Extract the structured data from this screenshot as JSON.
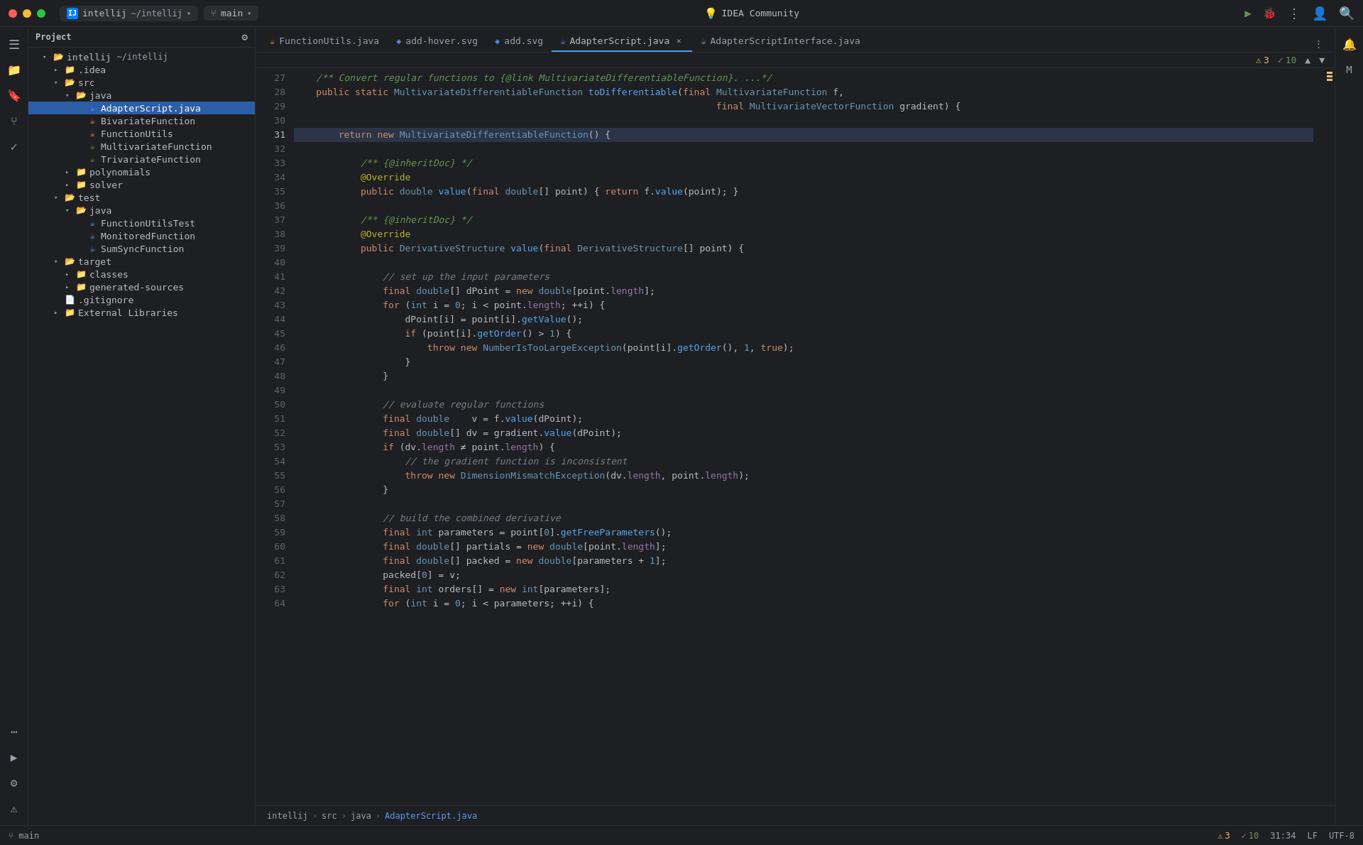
{
  "titlebar": {
    "project_name": "intellij",
    "project_path": "~/intellij",
    "branch_icon": "⑂",
    "branch_name": "main",
    "idea_label": "IDEA Community",
    "run_icon": "▶",
    "debug_icon": "🐛",
    "more_icon": "⋮",
    "profile_icon": "👤",
    "search_icon": "🔍"
  },
  "sidebar": {
    "title": "Project",
    "tree": [
      {
        "id": 1,
        "label": "intellij ~/intellij",
        "indent": 1,
        "type": "root",
        "expanded": true,
        "arrow": "▾"
      },
      {
        "id": 2,
        "label": ".idea",
        "indent": 2,
        "type": "folder",
        "expanded": false,
        "arrow": "▸"
      },
      {
        "id": 3,
        "label": "src",
        "indent": 2,
        "type": "folder",
        "expanded": true,
        "arrow": "▾"
      },
      {
        "id": 4,
        "label": "java",
        "indent": 3,
        "type": "folder",
        "expanded": true,
        "arrow": "▾"
      },
      {
        "id": 5,
        "label": "AdapterScript.java",
        "indent": 4,
        "type": "java-blue",
        "selected": true
      },
      {
        "id": 6,
        "label": "BivariateFunction",
        "indent": 4,
        "type": "java-orange"
      },
      {
        "id": 7,
        "label": "FunctionUtils",
        "indent": 4,
        "type": "java-orange"
      },
      {
        "id": 8,
        "label": "MultivariateFunction",
        "indent": 4,
        "type": "java-green"
      },
      {
        "id": 9,
        "label": "TrivariateFunction",
        "indent": 4,
        "type": "java-green"
      },
      {
        "id": 10,
        "label": "polynomials",
        "indent": 3,
        "type": "folder",
        "expanded": false,
        "arrow": "▸"
      },
      {
        "id": 11,
        "label": "solver",
        "indent": 3,
        "type": "folder",
        "expanded": false,
        "arrow": "▸"
      },
      {
        "id": 12,
        "label": "test",
        "indent": 2,
        "type": "folder",
        "expanded": true,
        "arrow": "▾"
      },
      {
        "id": 13,
        "label": "java",
        "indent": 3,
        "type": "folder",
        "expanded": true,
        "arrow": "▾"
      },
      {
        "id": 14,
        "label": "FunctionUtilsTest",
        "indent": 4,
        "type": "java-blue"
      },
      {
        "id": 15,
        "label": "MonitoredFunction",
        "indent": 4,
        "type": "java-blue"
      },
      {
        "id": 16,
        "label": "SumSyncFunction",
        "indent": 4,
        "type": "java-blue"
      },
      {
        "id": 17,
        "label": "target",
        "indent": 2,
        "type": "folder",
        "expanded": true,
        "arrow": "▾"
      },
      {
        "id": 18,
        "label": "classes",
        "indent": 3,
        "type": "folder",
        "expanded": false,
        "arrow": "▸"
      },
      {
        "id": 19,
        "label": "generated-sources",
        "indent": 3,
        "type": "folder",
        "expanded": false,
        "arrow": "▸"
      },
      {
        "id": 20,
        "label": ".gitignore",
        "indent": 2,
        "type": "file"
      },
      {
        "id": 21,
        "label": "External Libraries",
        "indent": 2,
        "type": "folder",
        "expanded": false,
        "arrow": "▸"
      }
    ]
  },
  "tabs": [
    {
      "id": 1,
      "label": "FunctionUtils.java",
      "type": "java",
      "active": false,
      "modified": false
    },
    {
      "id": 2,
      "label": "add-hover.svg",
      "type": "svg",
      "active": false,
      "modified": false
    },
    {
      "id": 3,
      "label": "add.svg",
      "type": "svg",
      "active": false,
      "modified": false
    },
    {
      "id": 4,
      "label": "AdapterScript.java",
      "type": "java",
      "active": true,
      "modified": false
    },
    {
      "id": 5,
      "label": "AdapterScriptInterface.java",
      "type": "java",
      "active": false,
      "modified": false
    }
  ],
  "editor": {
    "lines": [
      {
        "num": 27,
        "content": "    /** Convert regular functions to {@link MultivariateDifferentiableFunction}. ...*/"
      },
      {
        "num": 28,
        "content": "    public static MultivariateDifferentiableFunction toDifferentiable(final MultivariateFunction f,"
      },
      {
        "num": 29,
        "content": "                                                                            final MultivariateVectorFunction gradient) {"
      },
      {
        "num": 30,
        "content": ""
      },
      {
        "num": 31,
        "content": "        return new MultivariateDifferentiableFunction() {",
        "highlighted": true
      },
      {
        "num": 32,
        "content": ""
      },
      {
        "num": 33,
        "content": "            /** {@inheritDoc} */"
      },
      {
        "num": 34,
        "content": "            @Override"
      },
      {
        "num": 35,
        "content": "            public double value(final double[] point) { return f.value(point); }"
      },
      {
        "num": 36,
        "content": ""
      },
      {
        "num": 37,
        "content": "            /** {@inheritDoc} */"
      },
      {
        "num": 38,
        "content": "            @Override"
      },
      {
        "num": 39,
        "content": "            public DerivativeStructure value(final DerivativeStructure[] point) {"
      },
      {
        "num": 40,
        "content": ""
      },
      {
        "num": 41,
        "content": "                // set up the input parameters"
      },
      {
        "num": 42,
        "content": "                final double[] dPoint = new double[point.length];"
      },
      {
        "num": 43,
        "content": "                for (int i = 0; i < point.length; ++i) {"
      },
      {
        "num": 44,
        "content": "                    dPoint[i] = point[i].getValue();"
      },
      {
        "num": 45,
        "content": "                    if (point[i].getOrder() > 1) {"
      },
      {
        "num": 46,
        "content": "                        throw new NumberIsTooLargeException(point[i].getOrder(), 1, true);"
      },
      {
        "num": 47,
        "content": "                    }"
      },
      {
        "num": 48,
        "content": "                }"
      },
      {
        "num": 49,
        "content": ""
      },
      {
        "num": 50,
        "content": "                // evaluate regular functions"
      },
      {
        "num": 51,
        "content": "                final double    v = f.value(dPoint);"
      },
      {
        "num": 52,
        "content": "                final double[] dv = gradient.value(dPoint);"
      },
      {
        "num": 53,
        "content": "                if (dv.length ≠ point.length) {"
      },
      {
        "num": 54,
        "content": "                    // the gradient function is inconsistent"
      },
      {
        "num": 55,
        "content": "                    throw new DimensionMismatchException(dv.length, point.length);"
      },
      {
        "num": 56,
        "content": "                }"
      },
      {
        "num": 57,
        "content": ""
      },
      {
        "num": 58,
        "content": "                // build the combined derivative"
      },
      {
        "num": 59,
        "content": "                final int parameters = point[0].getFreeParameters();"
      },
      {
        "num": 60,
        "content": "                final double[] partials = new double[point.length];"
      },
      {
        "num": 61,
        "content": "                final double[] packed = new double[parameters + 1];"
      },
      {
        "num": 62,
        "content": "                packed[0] = v;"
      },
      {
        "num": 63,
        "content": "                final int orders[] = new int[parameters];"
      },
      {
        "num": 64,
        "content": "                for (int i = 0; i < parameters; ++i) {"
      }
    ]
  },
  "warnings": {
    "count": 3,
    "ok_count": 10
  },
  "status_bar": {
    "branch": "main",
    "position": "31:34",
    "lf": "LF",
    "encoding": "UTF-8",
    "project_label": "intellij",
    "src": "src",
    "java": "java",
    "file": "AdapterScript.java"
  },
  "breadcrumb": {
    "items": [
      "intellij",
      "src",
      "java",
      "AdapterScript.java"
    ]
  }
}
